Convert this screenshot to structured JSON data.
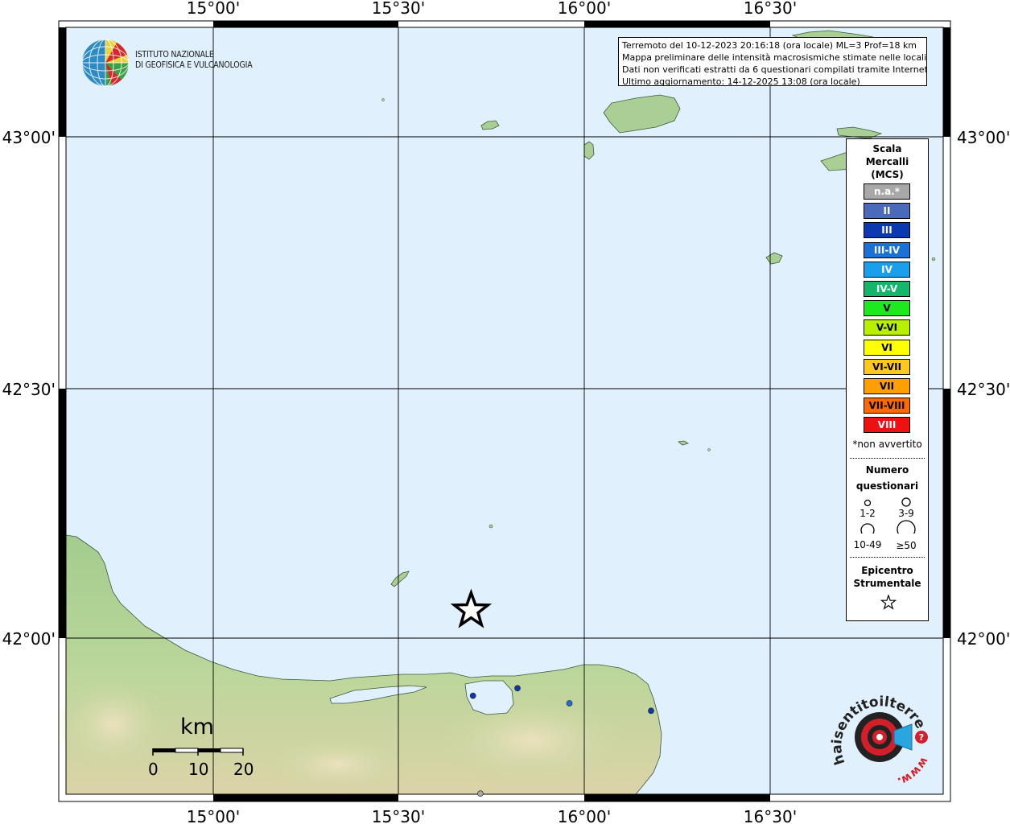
{
  "map": {
    "lon_labels": [
      "15°00'",
      "15°30'",
      "16°00'",
      "16°30'"
    ],
    "lat_labels": [
      "43°00'",
      "42°30'",
      "42°00'"
    ],
    "colors": {
      "sea": "#e0f0fc",
      "land_low": "#a9cf94",
      "land_high": "#e9ddb4",
      "frame": "#000000",
      "grid": "#000000"
    }
  },
  "logo": {
    "line1": "ISTITUTO NAZIONALE",
    "line2": "DI GEOFISICA E VULCANOLOGIA",
    "icon": "ingv-globe-icon"
  },
  "info": {
    "line1": "Terremoto del 10-12-2023 20:16:18 (ora locale) ML=3 Prof=18 km",
    "line2": "Mappa preliminare delle intensità macrosismiche stimate nelle località",
    "line3": "Dati non verificati estratti da 6 questionari compilati tramite Internet.",
    "line4": "Ultimo aggiornamento: 14-12-2025 13:08 (ora locale)"
  },
  "legend": {
    "title1": "Scala",
    "title2": "Mercalli",
    "title3": "(MCS)",
    "classes": [
      {
        "label": "n.a.*",
        "color": "#a8a8a8"
      },
      {
        "label": "II",
        "color": "#4a6aba"
      },
      {
        "label": "III",
        "color": "#0b3ab0"
      },
      {
        "label": "III-IV",
        "color": "#1a72d8"
      },
      {
        "label": "IV",
        "color": "#1aa0ea"
      },
      {
        "label": "IV-V",
        "color": "#13b66a"
      },
      {
        "label": "V",
        "color": "#1ee81e"
      },
      {
        "label": "V-VI",
        "color": "#b8f000"
      },
      {
        "label": "VI",
        "color": "#ffff00"
      },
      {
        "label": "VI-VII",
        "color": "#ffc81a"
      },
      {
        "label": "VII",
        "color": "#ffa000"
      },
      {
        "label": "VII-VIII",
        "color": "#ff6a00"
      },
      {
        "label": "VIII",
        "color": "#ee1111"
      }
    ],
    "note": "*non avvertito",
    "count_title1": "Numero",
    "count_title2": "questionari",
    "count_1": "1-2",
    "count_2": "3-9",
    "count_3": "10-49",
    "count_4": "≥50",
    "epi_title1": "Epicentro",
    "epi_title2": "Strumentale"
  },
  "scalebar": {
    "unit": "km",
    "ticks": [
      "0",
      "10",
      "20"
    ]
  },
  "reports": [
    {
      "color": "#0b3ab0",
      "place_lon": 15.7,
      "place_lat": 41.885
    },
    {
      "color": "#0b3ab0",
      "place_lon": 15.82,
      "place_lat": 41.9
    },
    {
      "color": "#1a72d8",
      "place_lon": 15.96,
      "place_lat": 41.87
    },
    {
      "color": "#0b3ab0",
      "place_lon": 16.18,
      "place_lat": 41.855
    },
    {
      "color": "#a8a8a8",
      "place_lon": 15.72,
      "place_lat": 41.69
    }
  ],
  "epicenter": {
    "lon": 15.695,
    "lat": 42.055
  },
  "brand": {
    "text": "haisentitoilterremoto.it",
    "url_text": "www.",
    "icon": "hai-sentito-target-icon"
  }
}
